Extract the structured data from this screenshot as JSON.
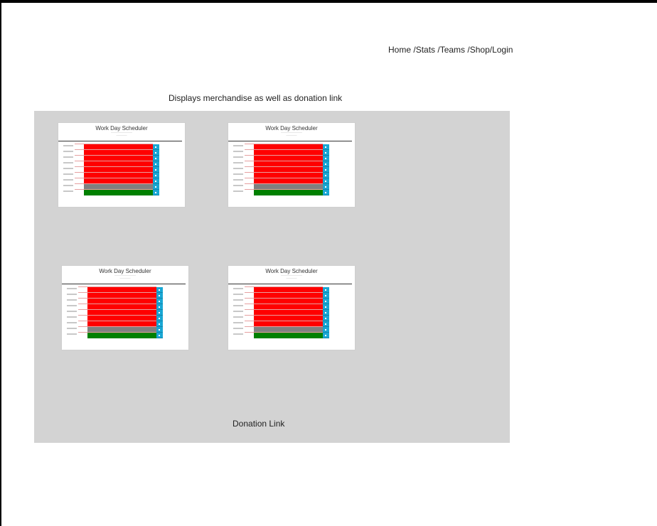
{
  "nav": {
    "items": [
      "Home /",
      "Stats /",
      "Teams /",
      "Shop/",
      "Login"
    ]
  },
  "caption": "Displays merchandise as well as donation link",
  "merch_items": [
    {
      "title": "Work Day Scheduler"
    },
    {
      "title": "Work Day Scheduler"
    },
    {
      "title": "Work Day Scheduler"
    },
    {
      "title": "Work Day Scheduler"
    }
  ],
  "slot_statuses": [
    "future",
    "future",
    "future",
    "future",
    "future",
    "future",
    "future",
    "past",
    "present"
  ],
  "colors": {
    "future": "#ff0000",
    "past": "#808080",
    "present": "#008000",
    "save": "#19a7d4",
    "panel": "#d3d3d3"
  },
  "donation_link": "Donation Link"
}
